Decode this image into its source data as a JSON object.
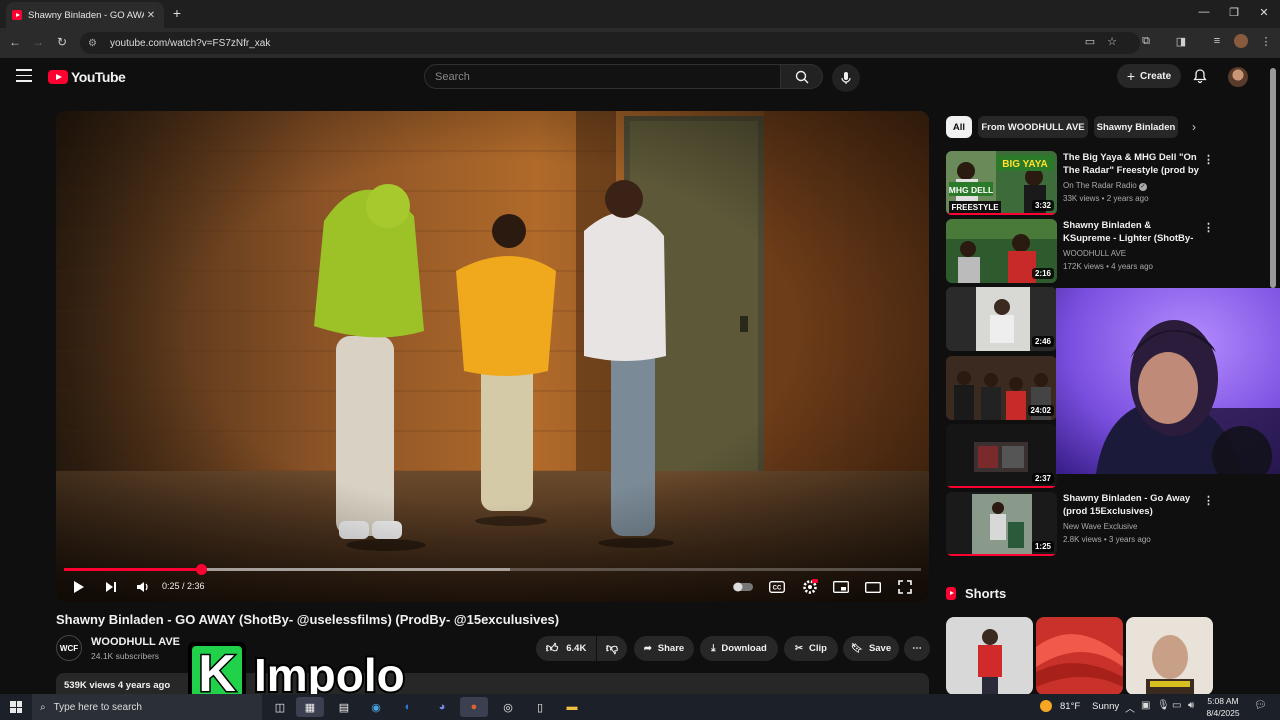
{
  "browser": {
    "tab_title": "Shawny Binladen - GO AWAY (S",
    "url": "youtube.com/watch?v=FS7zNfr_xak"
  },
  "youtube": {
    "logo_text": "YouTube",
    "search_placeholder": "Search",
    "create_label": "Create"
  },
  "player": {
    "time_current": "0:25",
    "time_total": "2:36",
    "time_display": "0:25 / 2:36",
    "progress_fraction": 0.16,
    "buffer_fraction": 0.52
  },
  "video": {
    "title": "Shawny Binladen - GO AWAY (ShotBy- @uselessfilms) (ProdBy- @15exculusives)",
    "channel_avatar_text": "WCF",
    "channel_name": "WOODHULL AVE",
    "subscribers": "24.1K subscribers",
    "likes": "6.4K",
    "share_label": "Share",
    "download_label": "Download",
    "clip_label": "Clip",
    "save_label": "Save",
    "views_date": "539K views  4 years ago"
  },
  "overlay": {
    "watermark_k": "K",
    "watermark_text": "Impolo"
  },
  "sidebar": {
    "chips": [
      "All",
      "From WOODHULL AVE",
      "Shawny Binladen"
    ],
    "recommendations": [
      {
        "title": "The Big Yaya & MHG Dell \"On The Radar\" Freestyle (prod by ...",
        "channel": "On The Radar Radio",
        "verified": true,
        "meta": "33K views • 2 years ago",
        "duration": "3:32",
        "watched": 1.0,
        "thumb_texts": [
          "BIG YAYA",
          "MHG DELL",
          "FREESTYLE"
        ]
      },
      {
        "title": "Shawny Binladen & KSupreme - Lighter  (ShotBy- ...",
        "channel": "WOODHULL AVE",
        "verified": false,
        "meta": "172K views • 4 years ago",
        "duration": "2:16",
        "watched": 0.0
      },
      {
        "title": "",
        "channel": "",
        "meta": "",
        "duration": "2:46",
        "watched": 0.0
      },
      {
        "title": "",
        "channel": "",
        "meta": "",
        "duration": "24:02",
        "watched": 0.0
      },
      {
        "title": "",
        "channel": "",
        "meta": "",
        "duration": "2:37",
        "watched": 1.0
      },
      {
        "title": "Shawny Binladen - Go Away (prod 15Exclusives)",
        "channel": "New Wave Exclusive",
        "verified": false,
        "meta": "2.8K views • 3 years ago",
        "duration": "1:25",
        "watched": 1.0
      }
    ],
    "shorts_label": "Shorts"
  },
  "taskbar": {
    "search_placeholder": "Type here to search",
    "temperature": "81°F",
    "condition": "Sunny",
    "time": "5:08 AM",
    "date": "8/4/2025"
  },
  "colors": {
    "brand_red": "#ff0033",
    "background": "#0f0f0f",
    "surface": "#272727"
  }
}
